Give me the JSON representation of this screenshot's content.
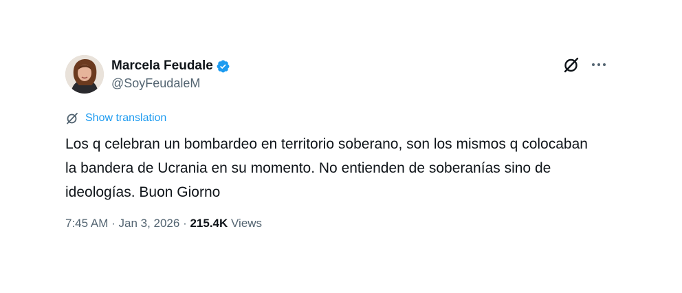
{
  "author": {
    "display_name": "Marcela Feudale",
    "handle": "@SoyFeudaleM",
    "verified": true,
    "verified_color": "#1d9bf0"
  },
  "actions": {
    "grok_icon": "grok-icon",
    "more_icon": "more-icon"
  },
  "translation": {
    "label": "Show translation",
    "color": "#1d9bf0"
  },
  "tweet": {
    "text": "Los q celebran un bombardeo en territorio soberano, son los mismos q colocaban la bandera de Ucrania en su momento. No entienden de soberanías sino de ideologías. Buon Giorno"
  },
  "meta": {
    "time": "7:45 AM",
    "separator": " · ",
    "date": "Jan 3, 2026",
    "views_count": "215.4K",
    "views_label": "Views"
  }
}
